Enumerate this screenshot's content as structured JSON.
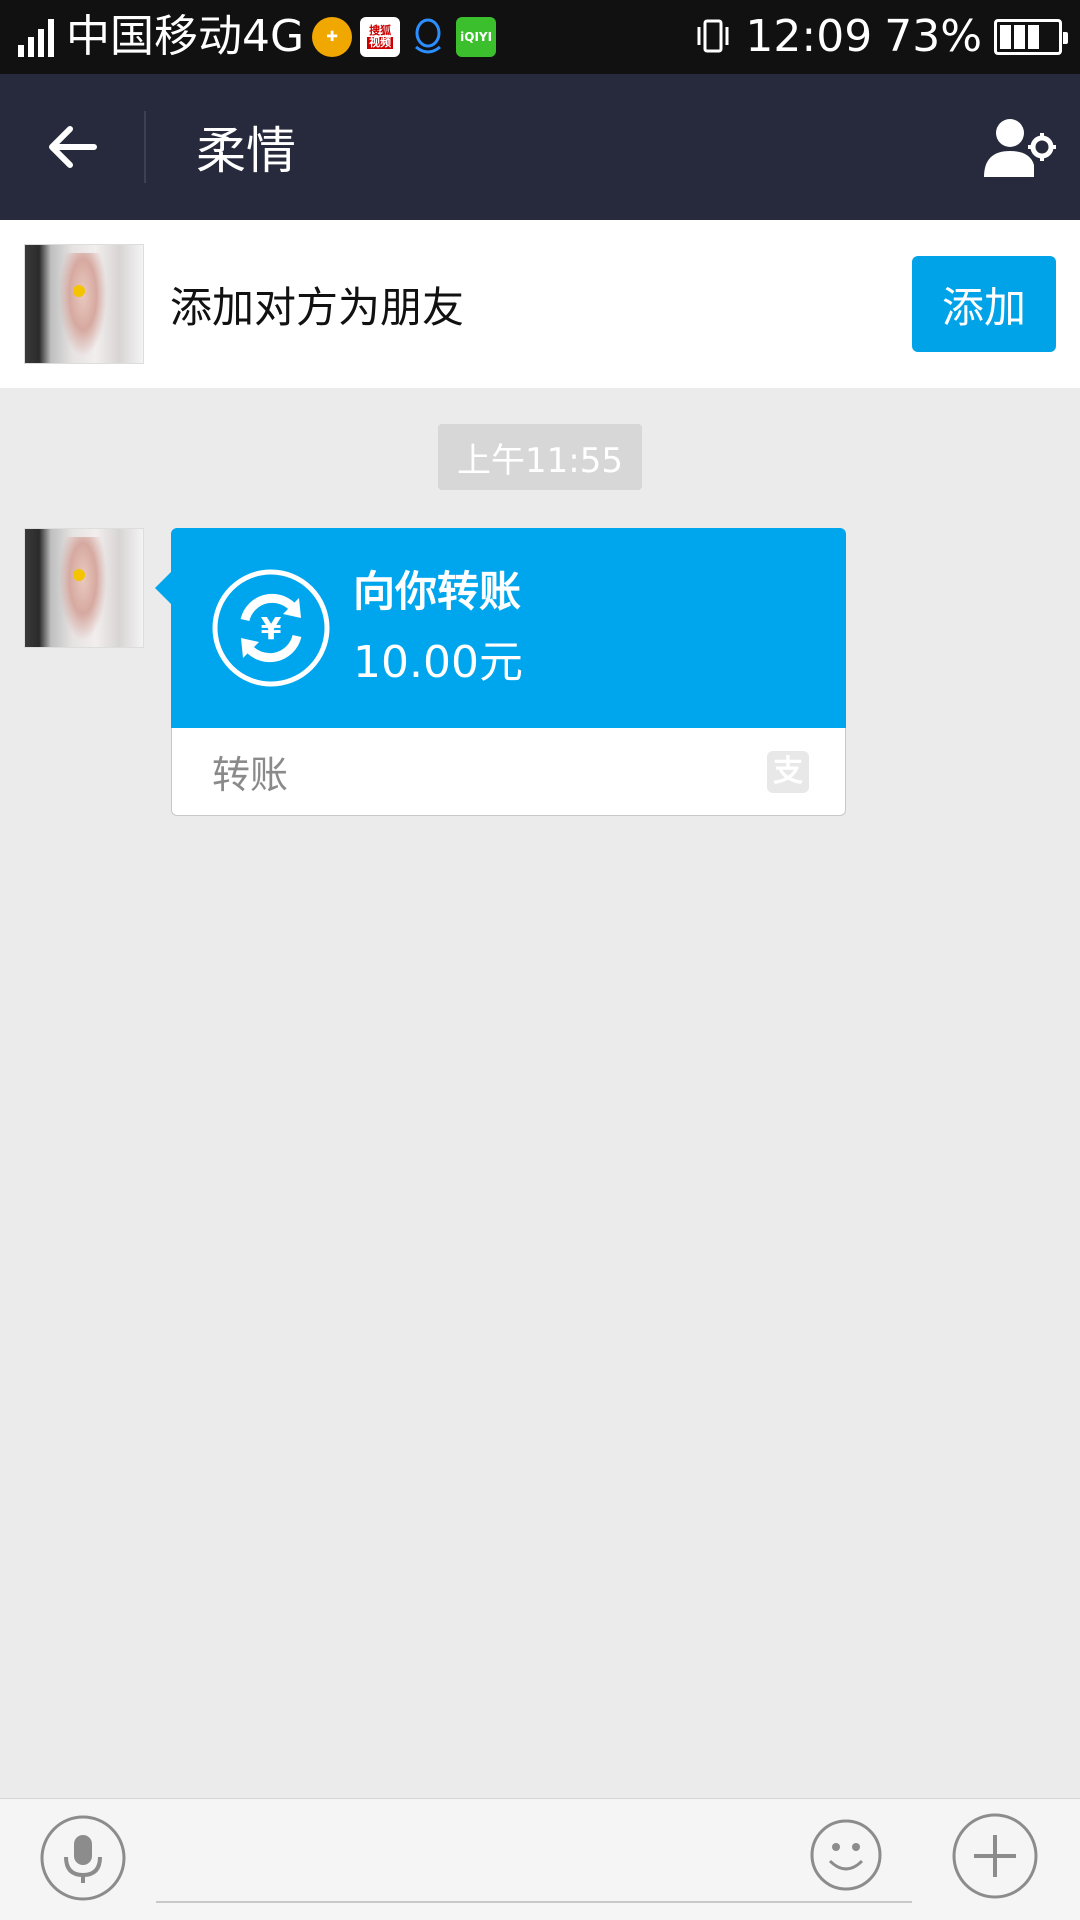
{
  "statusbar": {
    "network_tag": "4G",
    "carrier": "中国移动4G",
    "app_icons": [
      "shield-plus-icon",
      "sohu-video-icon",
      "qq-icon",
      "iqiyi-icon"
    ],
    "sohu_label_top": "搜狐",
    "sohu_label_bottom": "视频",
    "iqiyi_label": "iQIYI",
    "time": "12:09",
    "battery": "73%"
  },
  "navbar": {
    "title": "柔情",
    "bg_color": "#262a3c"
  },
  "add_friend_bar": {
    "text": "添加对方为朋友",
    "button_label": "添加",
    "accent": "#00a2e8"
  },
  "chat": {
    "timestamp": "上午11:55",
    "transfer": {
      "title": "向你转账",
      "amount": "10.00元",
      "label": "转账",
      "brand_glyph": "支",
      "color": "#00a6ed"
    }
  },
  "inputbar": {
    "text_value": "",
    "icons": [
      "microphone-icon",
      "emoji-icon",
      "plus-icon"
    ]
  }
}
